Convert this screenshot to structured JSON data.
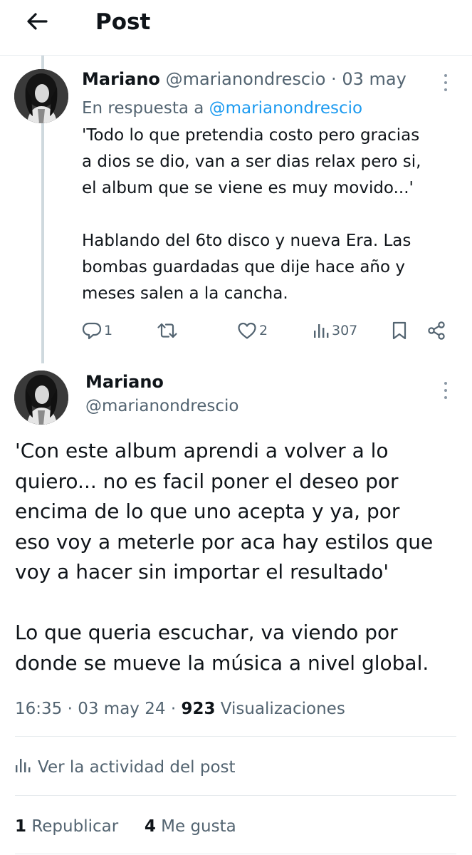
{
  "header": {
    "title": "Post"
  },
  "reply_post": {
    "author_name": "Mariano",
    "author_handle": "@marianondrescio",
    "separator": "·",
    "date": "03 may",
    "in_reply_prefix": "En respuesta a",
    "in_reply_handle": "@marianondrescio",
    "body_lines": [
      "'Todo lo que pretendia costo pero gracias",
      "a dios se dio, van a ser dias relax pero si,",
      "el album que se viene es muy movido...'",
      "",
      "Hablando del 6to disco y nueva Era. Las",
      "bombas guardadas que dije hace año y",
      "meses salen a la cancha."
    ],
    "stats": {
      "replies": "1",
      "reposts": "",
      "likes": "2",
      "views": "307"
    }
  },
  "main_post": {
    "author_name": "Mariano",
    "author_handle": "@marianondrescio",
    "body_lines": [
      "'Con este album aprendi a volver a lo",
      "quiero... no es facil poner el deseo por",
      "encima de lo que uno acepta y ya, por",
      "eso voy a meterle por aca hay estilos que",
      "voy a hacer sin importar el resultado'",
      "",
      "Lo que queria escuchar, va viendo por",
      "donde se mueve la música a nivel global."
    ],
    "time": "16:35",
    "dot": "·",
    "date": "03 may 24",
    "views_count": "923",
    "views_label": "Visualizaciones",
    "activity_label": "Ver la actividad del post",
    "reposts_count": "1",
    "reposts_label": "Republicar",
    "likes_count": "4",
    "likes_label": "Me gusta"
  },
  "colors": {
    "text": "#0f1419",
    "muted": "#536471",
    "link": "#1d9bf0",
    "divider": "#e7ebee",
    "thread_line": "#cfd9de"
  },
  "icons": [
    "arrow-left-icon",
    "more-vertical-icon",
    "reply-icon",
    "repost-icon",
    "like-icon",
    "views-icon",
    "bookmark-icon",
    "share-icon"
  ]
}
